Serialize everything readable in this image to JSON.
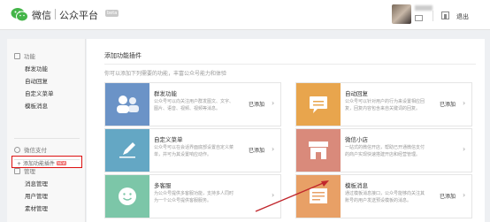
{
  "header": {
    "brand": "微信",
    "brand_sub": "公众平台",
    "beta": "beta",
    "logout": "退出"
  },
  "sidebar": {
    "section_function": "功能",
    "items": [
      "群发功能",
      "自动回复",
      "自定义菜单",
      "模板消息"
    ],
    "add_plugin": "添加功能插件",
    "add_plugin_badge": "NEW",
    "wechat_pay": "微信支付",
    "section_manage": "管理",
    "manage_items": [
      "消息管理",
      "用户管理",
      "素材管理"
    ]
  },
  "main": {
    "title": "添加功能插件",
    "subtitle": "你可以添加下列需要的功能，丰富公众号能力和体验",
    "cards": [
      {
        "name": "群发功能",
        "desc": "公众号可以向关注用户群发图文、文字、图片、语音、视频、视频等消息。",
        "status": "已添加",
        "color": "#6b93c7"
      },
      {
        "name": "自动回复",
        "desc": "公众号可以针对用户的行为来设置相应回复，回复内容包含来自关键词的回复。",
        "status": "已添加",
        "color": "#e8a54d"
      },
      {
        "name": "自定义菜单",
        "desc": "公众号可以在会话界面底部设置自定义菜单，并可为其设置响应动作。",
        "status": "已添加",
        "color": "#64a7c4"
      },
      {
        "name": "微信小店",
        "desc": "一站式的微信开店，帮助已开通微信支付的商户实现快速搭建开店和经营管理。",
        "status": "",
        "color": "#d98a7b"
      },
      {
        "name": "多客服",
        "desc": "为公众号提供多客服功能，支持多人同时为一个公众号提供客服服务。",
        "status": "",
        "color": "#7cc6a8"
      },
      {
        "name": "模板消息",
        "desc": "通过模板消息接口，公众号能够向关注其账号的用户发送预设模板的消息。",
        "status": "已添加",
        "color": "#e8a066"
      }
    ]
  }
}
